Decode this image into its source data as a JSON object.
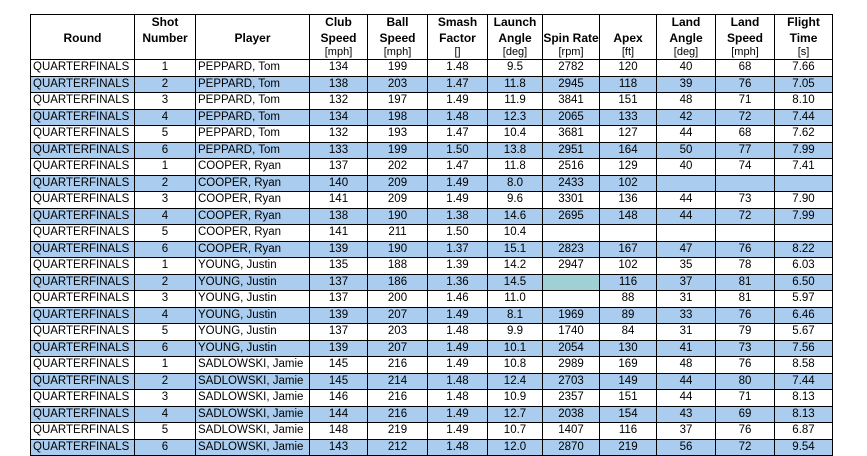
{
  "table": {
    "headers": [
      {
        "l1": "",
        "l2": "Round",
        "unit": ""
      },
      {
        "l1": "Shot",
        "l2": "Number",
        "unit": ""
      },
      {
        "l1": "",
        "l2": "Player",
        "unit": ""
      },
      {
        "l1": "Club",
        "l2": "Speed",
        "unit": "[mph]"
      },
      {
        "l1": "Ball",
        "l2": "Speed",
        "unit": "[mph]"
      },
      {
        "l1": "Smash",
        "l2": "Factor",
        "unit": "[]"
      },
      {
        "l1": "Launch",
        "l2": "Angle",
        "unit": "[deg]"
      },
      {
        "l1": "",
        "l2": "Spin Rate",
        "unit": "[rpm]"
      },
      {
        "l1": "",
        "l2": "Apex",
        "unit": "[ft]"
      },
      {
        "l1": "Land",
        "l2": "Angle",
        "unit": "[deg]"
      },
      {
        "l1": "Land",
        "l2": "Speed",
        "unit": "[mph]"
      },
      {
        "l1": "Flight",
        "l2": "Time",
        "unit": "[s]"
      }
    ],
    "rows": [
      [
        "QUARTERFINALS",
        "1",
        "PEPPARD, Tom",
        "134",
        "199",
        "1.48",
        "9.5",
        "2782",
        "120",
        "40",
        "68",
        "7.66"
      ],
      [
        "QUARTERFINALS",
        "2",
        "PEPPARD, Tom",
        "138",
        "203",
        "1.47",
        "11.8",
        "2945",
        "118",
        "39",
        "76",
        "7.05"
      ],
      [
        "QUARTERFINALS",
        "3",
        "PEPPARD, Tom",
        "132",
        "197",
        "1.49",
        "11.9",
        "3841",
        "151",
        "48",
        "71",
        "8.10"
      ],
      [
        "QUARTERFINALS",
        "4",
        "PEPPARD, Tom",
        "134",
        "198",
        "1.48",
        "12.3",
        "2065",
        "133",
        "42",
        "72",
        "7.44"
      ],
      [
        "QUARTERFINALS",
        "5",
        "PEPPARD, Tom",
        "132",
        "193",
        "1.47",
        "10.4",
        "3681",
        "127",
        "44",
        "68",
        "7.62"
      ],
      [
        "QUARTERFINALS",
        "6",
        "PEPPARD, Tom",
        "133",
        "199",
        "1.50",
        "13.8",
        "2951",
        "164",
        "50",
        "77",
        "7.99"
      ],
      [
        "QUARTERFINALS",
        "1",
        "COOPER, Ryan",
        "137",
        "202",
        "1.47",
        "11.8",
        "2516",
        "129",
        "40",
        "74",
        "7.41"
      ],
      [
        "QUARTERFINALS",
        "2",
        "COOPER, Ryan",
        "140",
        "209",
        "1.49",
        "8.0",
        "2433",
        "102",
        "",
        "",
        ""
      ],
      [
        "QUARTERFINALS",
        "3",
        "COOPER, Ryan",
        "141",
        "209",
        "1.49",
        "9.6",
        "3301",
        "136",
        "44",
        "73",
        "7.90"
      ],
      [
        "QUARTERFINALS",
        "4",
        "COOPER, Ryan",
        "138",
        "190",
        "1.38",
        "14.6",
        "2695",
        "148",
        "44",
        "72",
        "7.99"
      ],
      [
        "QUARTERFINALS",
        "5",
        "COOPER, Ryan",
        "141",
        "211",
        "1.50",
        "10.4",
        "",
        "",
        "",
        "",
        ""
      ],
      [
        "QUARTERFINALS",
        "6",
        "COOPER, Ryan",
        "139",
        "190",
        "1.37",
        "15.1",
        "2823",
        "167",
        "47",
        "76",
        "8.22"
      ],
      [
        "QUARTERFINALS",
        "1",
        "YOUNG, Justin",
        "135",
        "188",
        "1.39",
        "14.2",
        "2947",
        "102",
        "35",
        "78",
        "6.03"
      ],
      [
        "QUARTERFINALS",
        "2",
        "YOUNG, Justin",
        "137",
        "186",
        "1.36",
        "14.5",
        "",
        "116",
        "37",
        "81",
        "6.50"
      ],
      [
        "QUARTERFINALS",
        "3",
        "YOUNG, Justin",
        "137",
        "200",
        "1.46",
        "11.0",
        "",
        "88",
        "31",
        "81",
        "5.97"
      ],
      [
        "QUARTERFINALS",
        "4",
        "YOUNG, Justin",
        "139",
        "207",
        "1.49",
        "8.1",
        "1969",
        "89",
        "33",
        "76",
        "6.46"
      ],
      [
        "QUARTERFINALS",
        "5",
        "YOUNG, Justin",
        "137",
        "203",
        "1.48",
        "9.9",
        "1740",
        "84",
        "31",
        "79",
        "5.67"
      ],
      [
        "QUARTERFINALS",
        "6",
        "YOUNG, Justin",
        "139",
        "207",
        "1.49",
        "10.1",
        "2054",
        "130",
        "41",
        "73",
        "7.56"
      ],
      [
        "QUARTERFINALS",
        "1",
        "SADLOWSKI, Jamie",
        "145",
        "216",
        "1.49",
        "10.8",
        "2989",
        "169",
        "48",
        "76",
        "8.58"
      ],
      [
        "QUARTERFINALS",
        "2",
        "SADLOWSKI, Jamie",
        "145",
        "214",
        "1.48",
        "12.4",
        "2703",
        "149",
        "44",
        "80",
        "7.44"
      ],
      [
        "QUARTERFINALS",
        "3",
        "SADLOWSKI, Jamie",
        "146",
        "216",
        "1.48",
        "10.9",
        "2357",
        "151",
        "44",
        "71",
        "8.13"
      ],
      [
        "QUARTERFINALS",
        "4",
        "SADLOWSKI, Jamie",
        "144",
        "216",
        "1.49",
        "12.7",
        "2038",
        "154",
        "43",
        "69",
        "8.13"
      ],
      [
        "QUARTERFINALS",
        "5",
        "SADLOWSKI, Jamie",
        "148",
        "219",
        "1.49",
        "10.7",
        "1407",
        "116",
        "37",
        "76",
        "6.87"
      ],
      [
        "QUARTERFINALS",
        "6",
        "SADLOWSKI, Jamie",
        "143",
        "212",
        "1.48",
        "12.0",
        "2870",
        "219",
        "56",
        "72",
        "9.54"
      ]
    ]
  },
  "colors": {
    "row_shade": "#a9ccef",
    "spin_rate_highlight": "#9fd0d3"
  }
}
